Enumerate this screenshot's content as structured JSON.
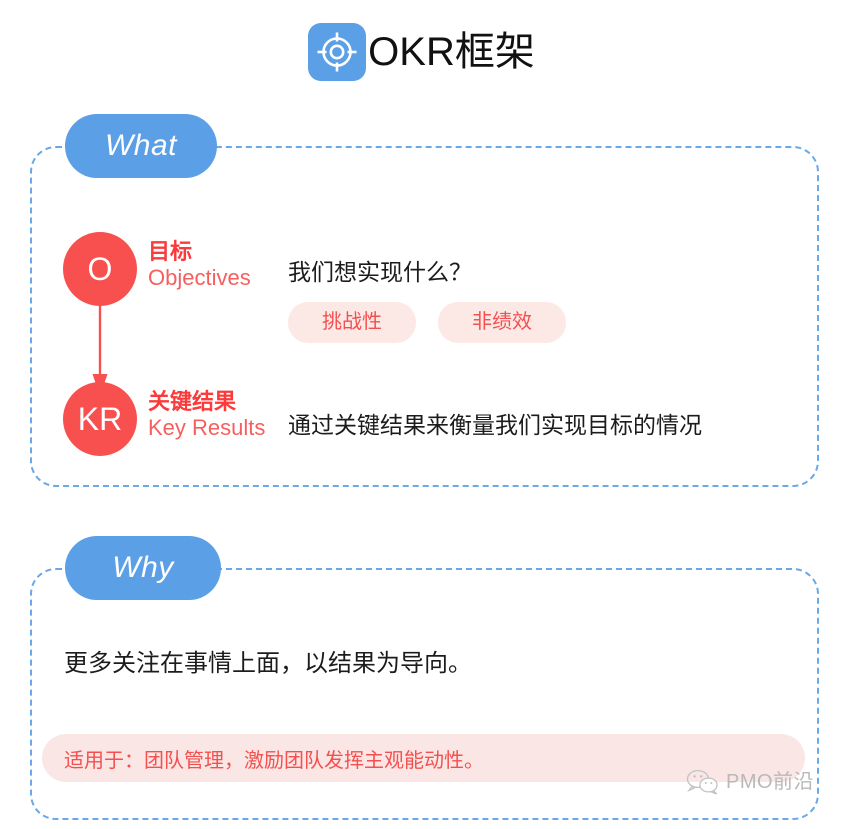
{
  "header": {
    "title": "OKR框架",
    "icon": "target-crosshair-icon"
  },
  "sections": [
    {
      "key": "what",
      "tab_label": "What",
      "nodes": [
        {
          "badge": "O",
          "label_cn": "目标",
          "label_en": "Objectives",
          "description": "我们想实现什么？",
          "tags": [
            "挑战性",
            "非绩效"
          ]
        },
        {
          "badge": "KR",
          "label_cn": "关键结果",
          "label_en": "Key Results",
          "description": "通过关键结果来衡量我们实现目标的情况",
          "tags": []
        }
      ]
    },
    {
      "key": "why",
      "tab_label": "Why",
      "lead_text": "更多关注在事情上面，以结果为导向。",
      "banner_text": "适用于：团队管理，激励团队发挥主观能动性。"
    }
  ],
  "watermark": {
    "text": "PMO前沿",
    "icon": "wechat-icon"
  },
  "colors": {
    "blue": "#5b9fe6",
    "dashed_border": "#6aa8e8",
    "red": "#f7504f",
    "red_bold": "#fb3b3b",
    "red_soft": "#f5605e",
    "pink_bg": "#fce9e6",
    "banner_bg": "#fae7e5",
    "text": "#1c1c1c",
    "watermark": "#b9b9b9"
  }
}
